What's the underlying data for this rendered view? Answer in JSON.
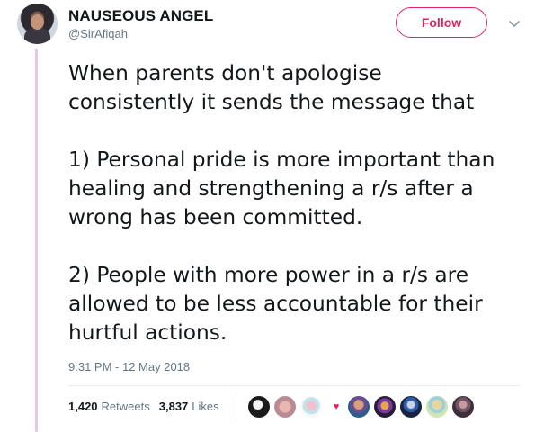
{
  "author": {
    "name": "NAUSEOUS ANGEL",
    "handle": "@SirAfiqah"
  },
  "follow_label": "Follow",
  "tweet": {
    "paragraphs": [
      [
        "When parents don't apologise",
        "consistently it sends the message that"
      ],
      [
        "1) Personal pride is more important than",
        "healing and strengthening a r/s after a",
        "wrong has been committed."
      ],
      [
        "2) People with more power in a r/s are",
        "allowed to be less accountable for their",
        "hurtful actions."
      ]
    ],
    "timestamp": "9:31 PM - 12 May 2018"
  },
  "stats": {
    "retweets_count": "1,420",
    "retweets_label": "Retweets",
    "likes_count": "3,837",
    "likes_label": "Likes"
  },
  "colors": {
    "accent": "#e0245e",
    "thread_line": "#e8c6e8",
    "text": "#14171a",
    "muted": "#657786"
  },
  "icons": {
    "caret": "chevron-down-icon",
    "heart": "heart-icon"
  }
}
